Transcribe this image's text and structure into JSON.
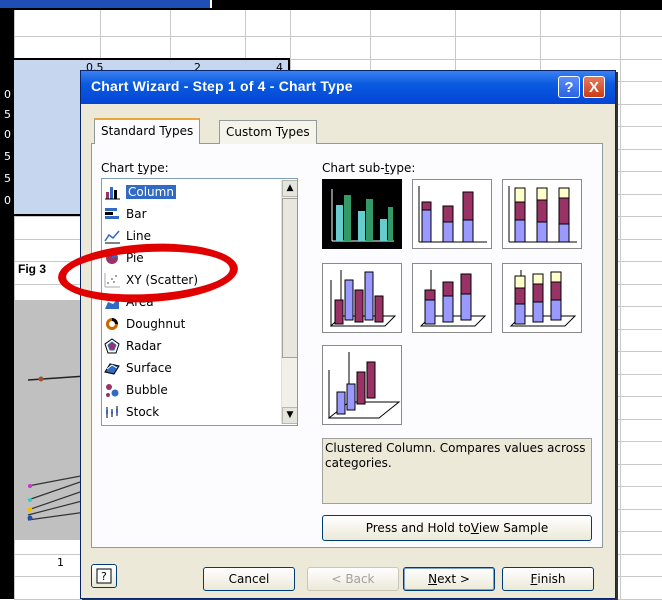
{
  "sheet": {
    "selection_values": [
      "0.5",
      "2",
      "4"
    ],
    "row_fragments": [
      "0",
      "5",
      "0",
      "5",
      "5",
      "0"
    ],
    "chart_label": "Fig 3",
    "axis_value": "1"
  },
  "dialog": {
    "title": "Chart Wizard - Step 1 of 4 - Chart Type",
    "help_glyph": "?",
    "close_glyph": "X",
    "tabs": [
      {
        "label": "Standard Types",
        "active": true
      },
      {
        "label": "Custom Types",
        "active": false
      }
    ],
    "chart_type_label_pre": "Chart ",
    "chart_type_label_u": "t",
    "chart_type_label_post": "ype:",
    "chart_subtype_label_pre": "Chart sub-",
    "chart_subtype_label_u": "t",
    "chart_subtype_label_post": "ype:",
    "chart_types": [
      {
        "label": "Column",
        "icon": "column-chart-icon",
        "selected": true
      },
      {
        "label": "Bar",
        "icon": "bar-chart-icon",
        "selected": false
      },
      {
        "label": "Line",
        "icon": "line-chart-icon",
        "selected": false
      },
      {
        "label": "Pie",
        "icon": "pie-chart-icon",
        "selected": false
      },
      {
        "label": "XY (Scatter)",
        "icon": "scatter-chart-icon",
        "selected": false
      },
      {
        "label": "Area",
        "icon": "area-chart-icon",
        "selected": false
      },
      {
        "label": "Doughnut",
        "icon": "doughnut-chart-icon",
        "selected": false
      },
      {
        "label": "Radar",
        "icon": "radar-chart-icon",
        "selected": false
      },
      {
        "label": "Surface",
        "icon": "surface-chart-icon",
        "selected": false
      },
      {
        "label": "Bubble",
        "icon": "bubble-chart-icon",
        "selected": false
      },
      {
        "label": "Stock",
        "icon": "stock-chart-icon",
        "selected": false
      }
    ],
    "description": "Clustered Column. Compares values across categories.",
    "press_hold_pre": "Press and Hold to ",
    "press_hold_u": "V",
    "press_hold_post": "iew Sample",
    "buttons": {
      "cancel": "Cancel",
      "back": "< Back",
      "next_u": "N",
      "next_post": "ext >",
      "finish_u": "F",
      "finish_post": "inish"
    },
    "colors": {
      "title_bar": "#0a5adf",
      "selection": "#316ac5",
      "highlight_ring": "#e00000",
      "series_purple": "#993366",
      "series_blue": "#9999ff",
      "series_cream": "#ffffcc",
      "series_teal": "#339966"
    }
  }
}
